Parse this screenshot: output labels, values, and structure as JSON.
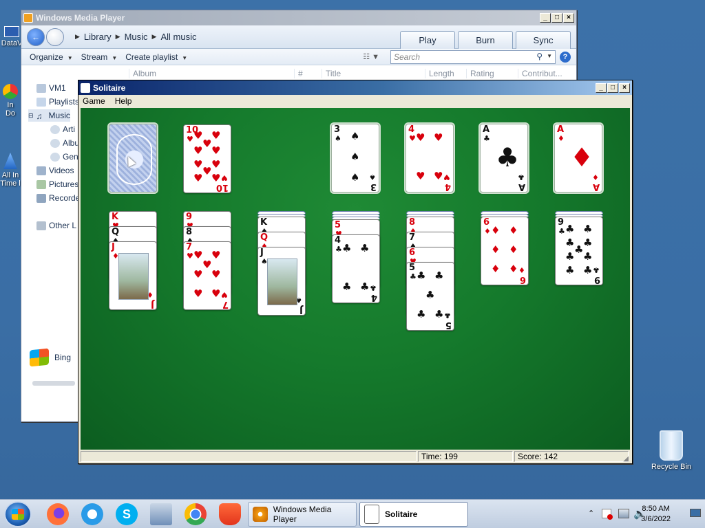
{
  "desktop": {
    "icons": [
      {
        "label": "DataV"
      },
      {
        "label": "In Do"
      },
      {
        "label": "All In Time l"
      }
    ],
    "recycle_bin": "Recycle Bin"
  },
  "wmp": {
    "title": "Windows Media Player",
    "breadcrumb": [
      "Library",
      "Music",
      "All music"
    ],
    "tabs": [
      "Play",
      "Burn",
      "Sync"
    ],
    "toolbar": [
      "Organize",
      "Stream",
      "Create playlist"
    ],
    "search_placeholder": "Search",
    "columns": [
      "Album",
      "#",
      "Title",
      "Length",
      "Rating",
      "Contribut..."
    ],
    "nav": [
      "VM1",
      "Playlists",
      "Music",
      "Arti",
      "Albu",
      "Gen",
      "Videos",
      "Pictures",
      "Recorde",
      "Other L"
    ],
    "bing": "Bing"
  },
  "solitaire": {
    "title": "Solitaire",
    "menu": [
      "Game",
      "Help"
    ],
    "time_label": "Time: 199",
    "score_label": "Score: 142",
    "colors": {
      "felt": "#157a2c",
      "red_suit": "#d8000c"
    },
    "waste": {
      "rank": "10",
      "suit": "♥"
    },
    "foundations": [
      {
        "rank": "3",
        "suit": "♠"
      },
      {
        "rank": "4",
        "suit": "♥"
      },
      {
        "rank": "A",
        "suit": "♣"
      },
      {
        "rank": "A",
        "suit": "♦"
      }
    ],
    "tableau": [
      {
        "cards": [
          {
            "rank": "K",
            "suit": "♥"
          },
          {
            "rank": "Q",
            "suit": "♠"
          },
          {
            "rank": "J",
            "suit": "♦"
          }
        ]
      },
      {
        "cards": [
          {
            "rank": "9",
            "suit": "♥"
          },
          {
            "rank": "8",
            "suit": "♠"
          },
          {
            "rank": "7",
            "suit": "♥"
          }
        ]
      },
      {
        "cards": [
          {
            "rank": "K",
            "suit": "♠"
          },
          {
            "rank": "Q",
            "suit": "♦"
          },
          {
            "rank": "J",
            "suit": "♠"
          }
        ]
      },
      {
        "cards": [
          {
            "rank": "5",
            "suit": "♥"
          },
          {
            "rank": "4",
            "suit": "♣"
          }
        ]
      },
      {
        "cards": [
          {
            "rank": "8",
            "suit": "♦"
          },
          {
            "rank": "7",
            "suit": "♠"
          },
          {
            "rank": "6",
            "suit": "♥"
          },
          {
            "rank": "5",
            "suit": "♣"
          }
        ]
      },
      {
        "cards": [
          {
            "rank": "6",
            "suit": "♦"
          }
        ]
      },
      {
        "cards": [
          {
            "rank": "9",
            "suit": "♣"
          }
        ]
      }
    ]
  },
  "taskbar": {
    "tasks": [
      "Windows Media Player",
      "Solitaire"
    ],
    "time": "8:50 AM",
    "date": "3/6/2022"
  }
}
